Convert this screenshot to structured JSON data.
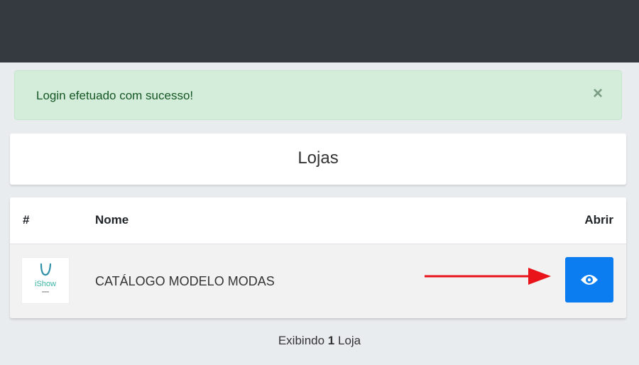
{
  "alert": {
    "message": "Login efetuado com sucesso!",
    "close_glyph": "×"
  },
  "card": {
    "title": "Lojas"
  },
  "table": {
    "headers": [
      "#",
      "Nome",
      "Abrir"
    ],
    "rows": [
      {
        "logo_icon": "ishow-logo-icon",
        "logo_text": "iShow",
        "name": "CATÁLOGO MODELO MODAS",
        "action_icon": "eye-icon"
      }
    ]
  },
  "footer": {
    "prefix": "Exibindo",
    "count": "1",
    "suffix": "Loja"
  },
  "colors": {
    "topbar": "#343a40",
    "alert_bg": "#d4edda",
    "button": "#0b7df0",
    "arrow": "#e8141a"
  }
}
